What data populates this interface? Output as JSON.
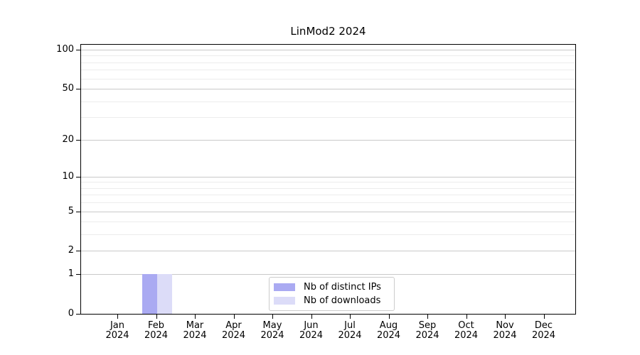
{
  "chart_data": {
    "type": "bar",
    "title": "LinMod2 2024",
    "categories": [
      "Jan",
      "Feb",
      "Mar",
      "Apr",
      "May",
      "Jun",
      "Jul",
      "Aug",
      "Sep",
      "Oct",
      "Nov",
      "Dec"
    ],
    "x_year": "2024",
    "series": [
      {
        "name": "Nb of distinct IPs",
        "color": "#aaaaf2",
        "values": [
          0,
          1,
          0,
          0,
          0,
          0,
          0,
          0,
          0,
          0,
          0,
          0
        ]
      },
      {
        "name": "Nb of downloads",
        "color": "#dcdcf8",
        "values": [
          0,
          1,
          0,
          0,
          0,
          0,
          0,
          0,
          0,
          0,
          0,
          0
        ]
      }
    ],
    "y_scale": "log10(1+y)",
    "y_major_ticks": [
      0,
      1,
      2,
      5,
      10,
      20,
      50,
      100
    ],
    "y_minor_gridlines": [
      3,
      4,
      6,
      7,
      8,
      9,
      30,
      40,
      60,
      70,
      80,
      90
    ],
    "ylim": [
      0,
      112
    ],
    "grid": true,
    "legend_position": "lower center"
  }
}
